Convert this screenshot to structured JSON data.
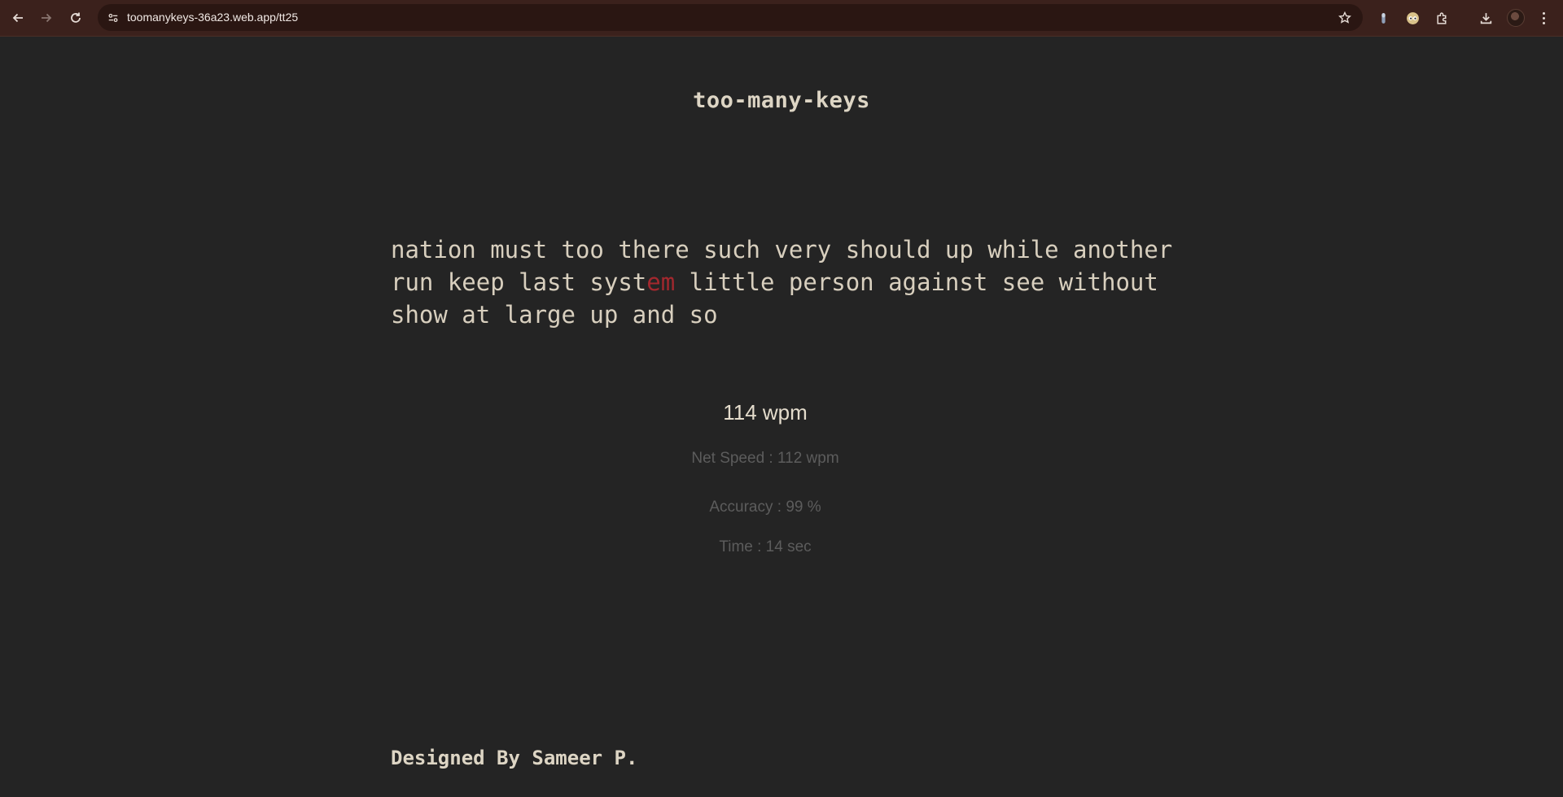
{
  "browser": {
    "url": "toomanykeys-36a23.web.app/tt25",
    "icons": {
      "back": "back-arrow-icon",
      "forward": "forward-arrow-icon",
      "reload": "reload-icon",
      "site_info": "site-info-icon",
      "bookmark": "star-icon",
      "extensions": "puzzle-icon",
      "download": "download-icon",
      "menu": "three-dots-icon"
    }
  },
  "app": {
    "title": "too-many-keys"
  },
  "typing": {
    "lines": [
      {
        "before": "nation must too there such very should up while another",
        "error": "",
        "after": ""
      },
      {
        "before": "run keep last syst",
        "error": "em",
        "after": " little person against see without"
      },
      {
        "before": "show at large up and so",
        "error": "",
        "after": ""
      }
    ]
  },
  "results": {
    "wpm": "114 wpm",
    "net_speed": "Net Speed : 112 wpm",
    "accuracy": "Accuracy : 99 %",
    "time": "Time : 14 sec"
  },
  "footer": {
    "credit": "Designed By Sameer P."
  },
  "colors": {
    "background": "#242424",
    "text": "#d8cfbe",
    "error": "#a3282e",
    "muted": "#5c5c5c",
    "chrome": "#3b211c"
  }
}
